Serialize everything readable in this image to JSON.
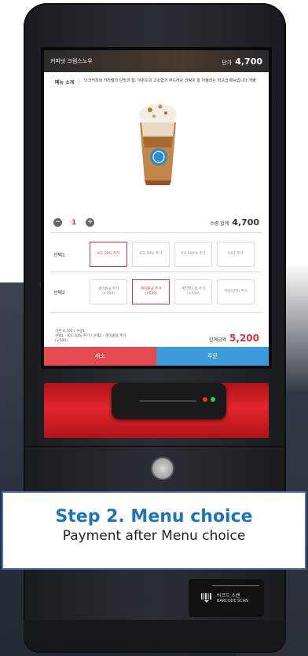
{
  "menu": {
    "name": "커피넛 크림스노우",
    "price_label": "단가",
    "price": "4,700",
    "intro_label": "메뉴 소개",
    "intro_text": "다크커피와 카라멜의 단맛과 함, 아몬드의 고소함과 부드러운 크림이 잘 어울리는 최고급 메뉴입니다 겨울"
  },
  "quantity": {
    "minus": "−",
    "value": "1",
    "plus": "+",
    "sum_label": "수량 합계",
    "sum": "4,700"
  },
  "choice1": {
    "label": "선택1",
    "options": [
      "ICE 20% 추가",
      "ICE 50% 추가",
      "ICE 100% 추가",
      "HOT 추가"
    ]
  },
  "choice2": {
    "label": "선택2",
    "options": [
      {
        "name": "헤이즐넛 추가",
        "price": "(+500)"
      },
      {
        "name": "헤이즐넛 추가",
        "price": "(+500)"
      },
      {
        "name": "캐러멜드립 추가",
        "price": "(+500)"
      },
      {
        "name": "흑당(반쪽) 추가",
        "price": ""
      }
    ]
  },
  "summary": {
    "line1": "기본 4,700 / 수량1",
    "line2": "선택1 - ICE 20% 추가 / 선택2 - 헤이즐넛 추가",
    "line3": "(+500)",
    "total_label": "합계금액",
    "total": "5,200"
  },
  "actions": {
    "cancel": "취소",
    "order": "주문"
  },
  "caption": {
    "title": "Step 2. Menu choice",
    "subtitle": "Payment after Menu choice"
  },
  "barcode": {
    "label_ko": "바코드 스캔",
    "label_en": "BARCODE SCAN"
  },
  "colors": {
    "accent_red": "#d8333a",
    "order_blue": "#3e9bd9",
    "cancel_red": "#e24a4f",
    "caption_blue": "#1e74b8"
  }
}
